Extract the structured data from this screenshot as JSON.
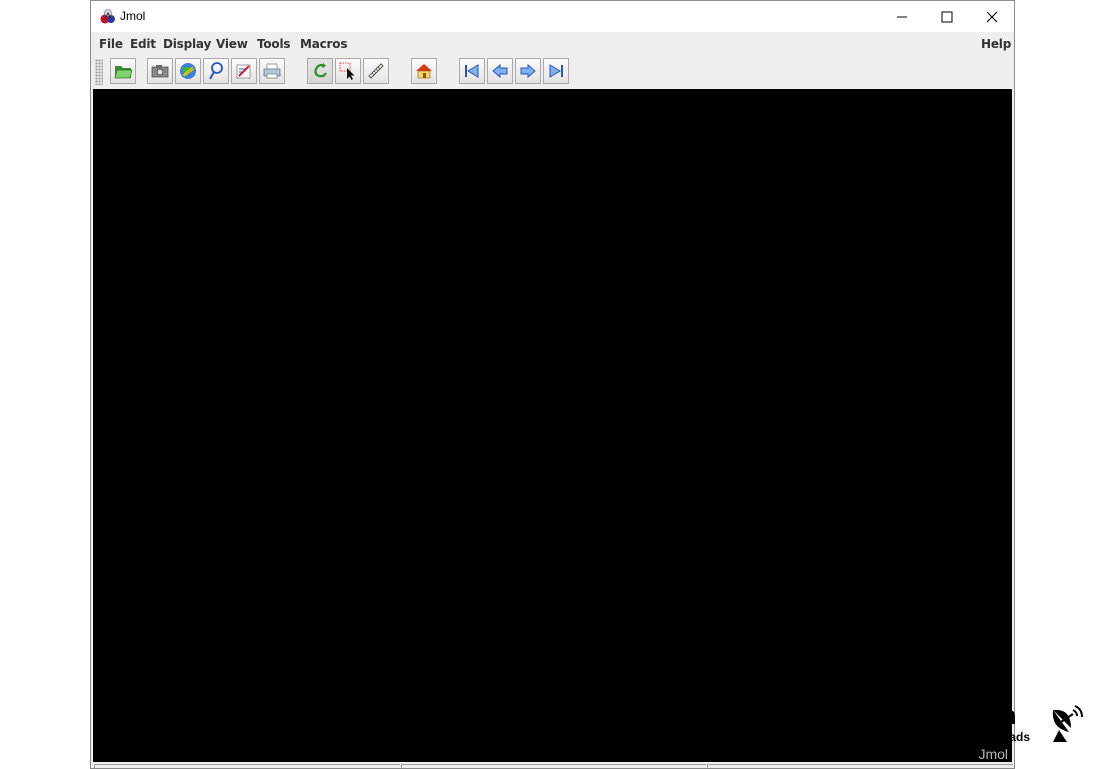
{
  "window": {
    "title": "Jmol",
    "icon": "jmol-app-icon"
  },
  "controls": {
    "minimize_icon": "minimize-icon",
    "maximize_icon": "maximize-icon",
    "close_icon": "close-icon"
  },
  "menu": {
    "file": "File",
    "edit": "Edit",
    "display": "Display",
    "view": "View",
    "tools": "Tools",
    "macros": "Macros",
    "help": "Help"
  },
  "toolbar": {
    "buttons": [
      {
        "name": "open-folder",
        "icon": "folder-open-icon"
      },
      {
        "name": "screenshot",
        "icon": "camera-icon"
      },
      {
        "name": "open-url",
        "icon": "globe-icon"
      },
      {
        "name": "script",
        "icon": "magnifier-icon"
      },
      {
        "name": "export",
        "icon": "edit-icon"
      },
      {
        "name": "print",
        "icon": "printer-icon"
      },
      {
        "name": "rotate",
        "icon": "rotate-icon",
        "pressed": true
      },
      {
        "name": "pick",
        "icon": "select-arrow-icon"
      },
      {
        "name": "measure",
        "icon": "ruler-icon"
      },
      {
        "name": "home",
        "icon": "home-icon"
      },
      {
        "name": "first-frame",
        "icon": "first-frame-icon"
      },
      {
        "name": "previous-frame",
        "icon": "previous-frame-icon"
      },
      {
        "name": "next-frame",
        "icon": "next-frame-icon"
      },
      {
        "name": "last-frame",
        "icon": "last-frame-icon"
      }
    ]
  },
  "viewer": {
    "background": "#000000",
    "label": "Jmol"
  },
  "watermark": {
    "text": "om",
    "subtext": "oads"
  }
}
